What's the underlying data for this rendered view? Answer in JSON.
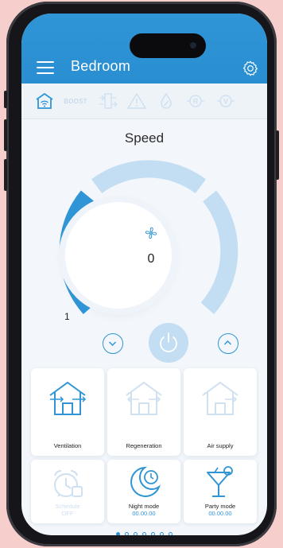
{
  "header": {
    "title": "Bedroom",
    "menu_icon": "hamburger-menu-icon",
    "settings_icon": "gear-icon"
  },
  "mode_bar": {
    "items": [
      {
        "name": "home-wifi-icon",
        "active": true
      },
      {
        "name": "boost-icon",
        "label": "BOOST",
        "active": false
      },
      {
        "name": "airflow-icon",
        "active": false
      },
      {
        "name": "warning-icon",
        "active": false
      },
      {
        "name": "humidity-icon",
        "active": false
      },
      {
        "name": "r-mode-icon",
        "label": "R",
        "active": false
      },
      {
        "name": "v-mode-icon",
        "label": "V",
        "active": false
      }
    ]
  },
  "speed": {
    "label": "Speed",
    "value": "0",
    "min_label": "1",
    "level_fraction": 0.33
  },
  "modes": [
    {
      "label": "Ventilation",
      "active": true
    },
    {
      "label": "Regeneration",
      "active": false
    },
    {
      "label": "Air supply",
      "active": false
    }
  ],
  "schedules": [
    {
      "label": "Schedule",
      "sub": "OFF",
      "active": false
    },
    {
      "label": "Night mode",
      "sub": "00.00.00",
      "active": true
    },
    {
      "label": "Party mode",
      "sub": "00.00.00",
      "active": true
    }
  ],
  "pagination": {
    "count": 7,
    "active_index": 0
  },
  "colors": {
    "accent": "#2f95d6",
    "inactive": "#c3ddf3",
    "background": "#f3f6fa"
  }
}
